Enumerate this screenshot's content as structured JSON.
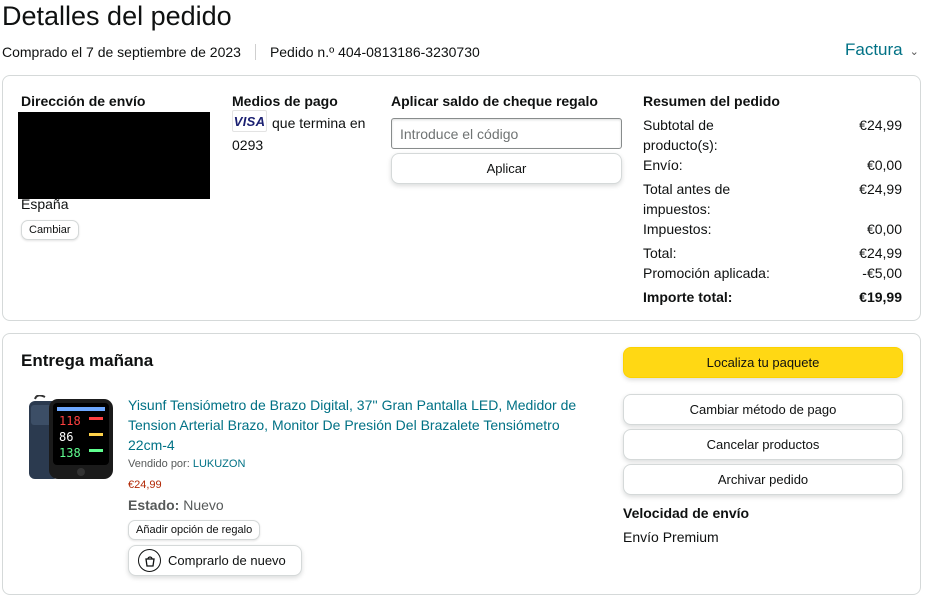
{
  "header": {
    "title": "Detalles del pedido",
    "purchase_date": "Comprado el 7 de septiembre de 2023",
    "order_number": "Pedido n.º 404-0813186-3230730",
    "invoice_label": "Factura"
  },
  "shipping": {
    "title": "Dirección de envío",
    "country": "España",
    "change_label": "Cambiar"
  },
  "payment": {
    "title": "Medios de pago",
    "card_brand": "VISA",
    "card_text": "que termina en 0293"
  },
  "gift": {
    "title": "Aplicar saldo de cheque regalo",
    "placeholder": "Introduce el código",
    "apply_label": "Aplicar"
  },
  "summary": {
    "title": "Resumen del pedido",
    "rows": [
      {
        "label": "Subtotal de producto(s):",
        "value": "€24,99"
      },
      {
        "label": "Envío:",
        "value": "€0,00"
      },
      {
        "label": "Total antes de impuestos:",
        "value": "€24,99"
      },
      {
        "label": "Impuestos:",
        "value": "€0,00"
      },
      {
        "label": "Total:",
        "value": "€24,99"
      },
      {
        "label": "Promoción aplicada:",
        "value": "-€5,00"
      },
      {
        "label": "Importe total:",
        "value": "€19,99"
      }
    ]
  },
  "delivery": {
    "title": "Entrega mañana",
    "product": {
      "title": "Yisunf Tensiómetro de Brazo Digital, 37'' Gran Pantalla LED, Medidor de Tension Arterial Brazo, Monitor De Presión Del Brazalete Tensiómetro 22cm-4",
      "sold_by_label": "Vendido por:",
      "seller": "LUKUZON",
      "price": "€24,99",
      "state_label": "Estado:",
      "state_value": "Nuevo",
      "gift_option_label": "Añadir opción de regalo",
      "rebuy_label": "Comprarlo de nuevo"
    },
    "actions": {
      "track": "Localiza tu paquete",
      "change_payment": "Cambiar método de pago",
      "cancel": "Cancelar productos",
      "archive": "Archivar pedido"
    },
    "speed_title": "Velocidad de envío",
    "speed_value": "Envío Premium"
  },
  "colors": {
    "link": "#007185",
    "price": "#b12704",
    "primary_button": "#ffd814",
    "border": "#d5d9d9"
  }
}
